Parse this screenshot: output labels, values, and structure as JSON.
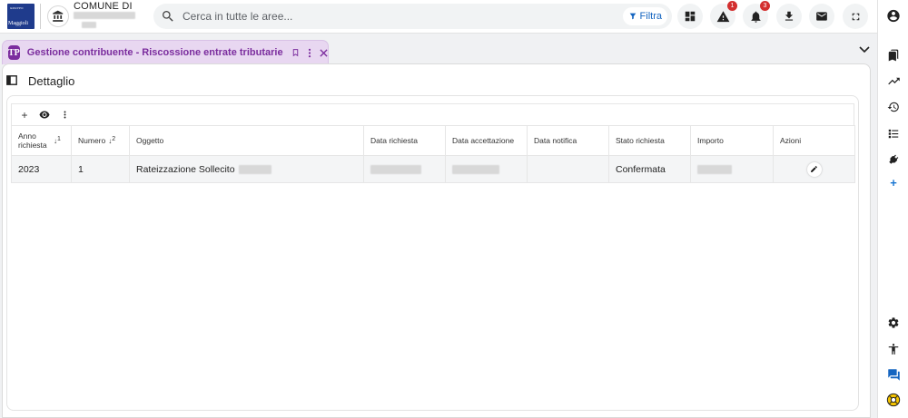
{
  "header": {
    "logo_text": "Maggioli",
    "logo_small": "GRUPPO",
    "comune_title": "COMUNE DI",
    "search_placeholder": "Cerca in tutte le aree...",
    "filter_label": "Filtra",
    "alerts_count": "1",
    "notifications_count": "3"
  },
  "tab": {
    "icon_letter": "TP",
    "label": "Gestione contribuente - Riscossione entrate tributarie"
  },
  "page": {
    "title": "Dettaglio"
  },
  "table": {
    "columns": {
      "anno": "Anno richiesta",
      "anno_sort": "1",
      "numero": "Numero",
      "numero_sort": "2",
      "oggetto": "Oggetto",
      "data_richiesta": "Data richiesta",
      "data_accettazione": "Data accettazione",
      "data_notifica": "Data notifica",
      "stato": "Stato richiesta",
      "importo": "Importo",
      "azioni": "Azioni"
    },
    "rows": [
      {
        "anno": "2023",
        "numero": "1",
        "oggetto": "Rateizzazione Sollecito",
        "stato": "Confermata"
      }
    ]
  },
  "colors": {
    "accent": "#7b2d9e",
    "tab_bg": "#e8d7f1",
    "filter": "#1565c0",
    "badge": "#d32f2f",
    "logo": "#1f3b8c"
  },
  "icons": {
    "rail": [
      "bookmarks-icon",
      "trending-up-icon",
      "history-icon",
      "checklist-icon",
      "plugin-icon",
      "add-icon",
      "settings-icon",
      "accessibility-icon",
      "chat-icon",
      "support-icon"
    ]
  }
}
